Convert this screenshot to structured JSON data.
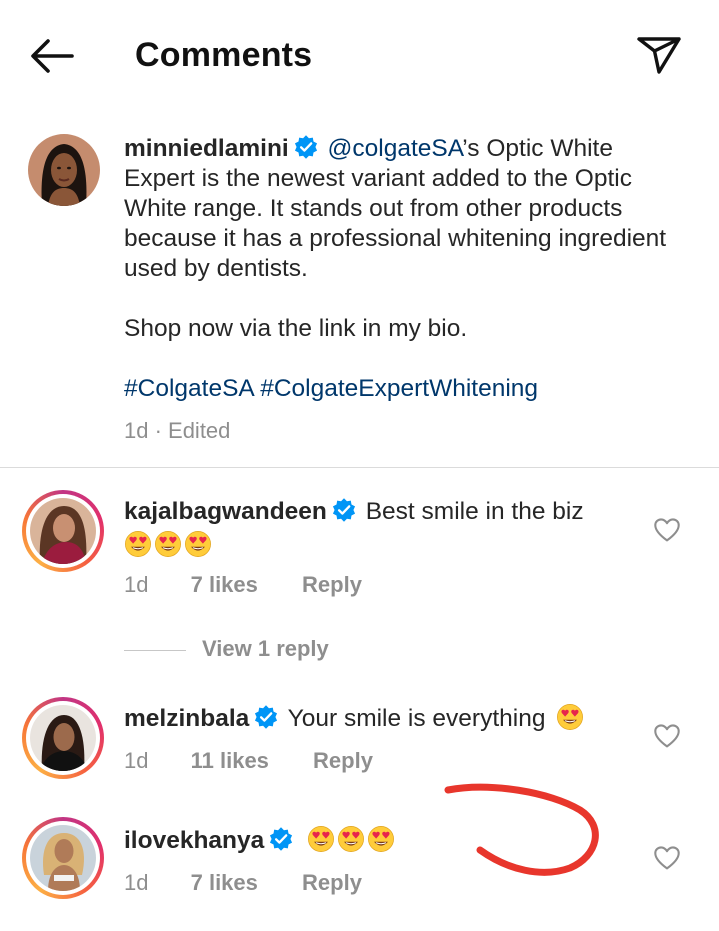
{
  "header": {
    "title": "Comments"
  },
  "caption": {
    "username": "minniedlamini",
    "mention": "@colgateSA",
    "text_after_mention": "’s Optic White Expert is the newest variant added to the Optic White range. It stands out from other products because it has a professional whitening ingredient used by dentists.",
    "text_line2": "Shop now via the link in my bio.",
    "hashtags": "#ColgateSA #ColgateExpertWhitening",
    "meta": "1d · Edited"
  },
  "comments": [
    {
      "username": "kajalbagwandeen",
      "text": "Best smile in the biz",
      "emoji_count": 3,
      "time": "1d",
      "likes": "7 likes",
      "reply": "Reply"
    },
    {
      "username": "melzinbala",
      "text": "Your smile is everything",
      "emoji_count": 1,
      "time": "1d",
      "likes": "11 likes",
      "reply": "Reply"
    },
    {
      "username": "ilovekhanya",
      "text": "",
      "emoji_count": 3,
      "time": "1d",
      "likes": "7 likes",
      "reply": "Reply"
    }
  ],
  "view_replies": "View 1 reply",
  "colors": {
    "link": "#00376b",
    "verified": "#0095f6",
    "muted": "#8e8e8e",
    "annotation": "#e8362c"
  },
  "icons": {
    "back": "arrow-left-icon",
    "send": "paper-plane-icon",
    "verified": "verified-badge-icon",
    "like": "heart-outline-icon",
    "emoji": "heart-eyes-emoji"
  }
}
